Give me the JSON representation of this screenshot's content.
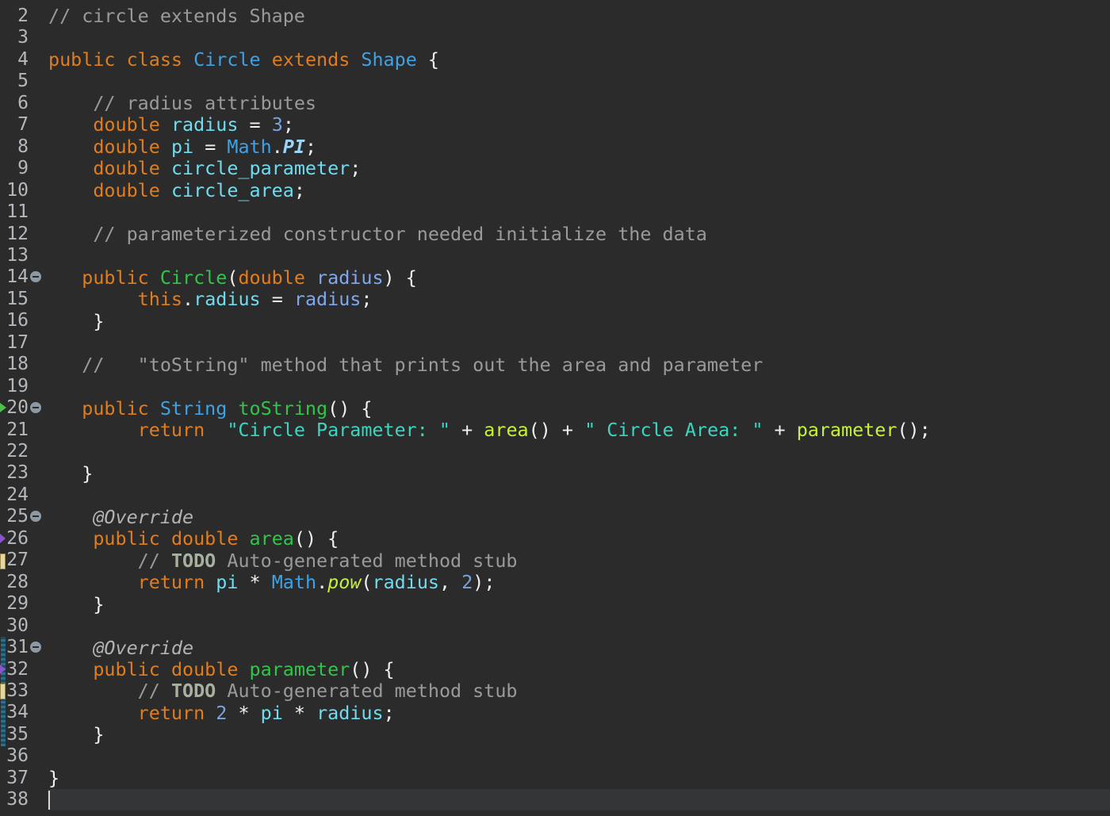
{
  "editor": {
    "line_numbers": [
      "2",
      "3",
      "4",
      "5",
      "6",
      "7",
      "8",
      "9",
      "10",
      "11",
      "12",
      "13",
      "14",
      "15",
      "16",
      "17",
      "18",
      "19",
      "20",
      "21",
      "22",
      "23",
      "24",
      "25",
      "26",
      "27",
      "28",
      "29",
      "30",
      "31",
      "32",
      "33",
      "34",
      "35",
      "36",
      "37",
      "38"
    ],
    "fold_markers": [
      "14",
      "20",
      "25",
      "31"
    ],
    "colors": {
      "background": "#2b2b2b",
      "keyword": "#e37c1a",
      "type": "#3ea2e6",
      "field": "#6fdcf0",
      "comment": "#9a9a9a",
      "string": "#37d8c2",
      "method_declaration": "#2fc64a",
      "method_call": "#c8f035"
    },
    "code": {
      "l2": {
        "comment": "// circle extends Shape"
      },
      "l4": {
        "kw1": "public",
        "kw2": "class",
        "name": "Circle",
        "kw3": "extends",
        "super": "Shape",
        "brace": "{"
      },
      "l6": {
        "comment": "// radius attributes"
      },
      "l7": {
        "type": "double",
        "field": "radius",
        "eq": "=",
        "value": "3",
        "semi": ";"
      },
      "l8": {
        "type": "double",
        "field": "pi",
        "eq": "=",
        "cls": "Math",
        "dot": ".",
        "const": "PI",
        "semi": ";"
      },
      "l9": {
        "type": "double",
        "field": "circle_parameter",
        "semi": ";"
      },
      "l10": {
        "type": "double",
        "field": "circle_area",
        "semi": ";"
      },
      "l12": {
        "comment": "// parameterized constructor needed initialize the data"
      },
      "l14": {
        "kw": "public",
        "name": "Circle",
        "open": "(",
        "type": "double",
        "param": "radius",
        "close": ") {"
      },
      "l15": {
        "kw": "this",
        "dot": ".",
        "field": "radius",
        "eq": "=",
        "param": "radius",
        "semi": ";"
      },
      "l16": {
        "brace": "}"
      },
      "l18": {
        "comment": "//   \"toString\" method that prints out the area and parameter"
      },
      "l20": {
        "kw": "public",
        "type": "String",
        "name": "toString",
        "rest": "() {"
      },
      "l21": {
        "kw": "return",
        "str1": "\"Circle Parameter: \"",
        "plus1": "+",
        "call1": "area",
        "p1": "()",
        "plus2": "+",
        "str2": "\" Circle Area: \"",
        "plus3": "+",
        "call2": "parameter",
        "p2": "();"
      },
      "l23": {
        "brace": "}"
      },
      "l25": {
        "annotation": "@Override"
      },
      "l26": {
        "kw1": "public",
        "kw2": "double",
        "name": "area",
        "rest": "() {"
      },
      "l27": {
        "slash": "//",
        "todo": "TODO",
        "text": "Auto-generated method stub"
      },
      "l28": {
        "kw": "return",
        "field": "pi",
        "op": "*",
        "cls": "Math",
        "dot": ".",
        "meth": "pow",
        "open": "(",
        "field2": "radius",
        "comma": ",",
        "num": "2",
        "close": ");"
      },
      "l29": {
        "brace": "}"
      },
      "l31": {
        "annotation": "@Override"
      },
      "l32": {
        "kw1": "public",
        "kw2": "double",
        "name": "parameter",
        "rest": "() {"
      },
      "l33": {
        "slash": "//",
        "todo": "TODO",
        "text": "Auto-generated method stub"
      },
      "l34": {
        "kw": "return",
        "num": "2",
        "op1": "*",
        "field1": "pi",
        "op2": "*",
        "field2": "radius",
        "semi": ";"
      },
      "l35": {
        "brace": "}"
      },
      "l37": {
        "brace": "}"
      }
    }
  }
}
